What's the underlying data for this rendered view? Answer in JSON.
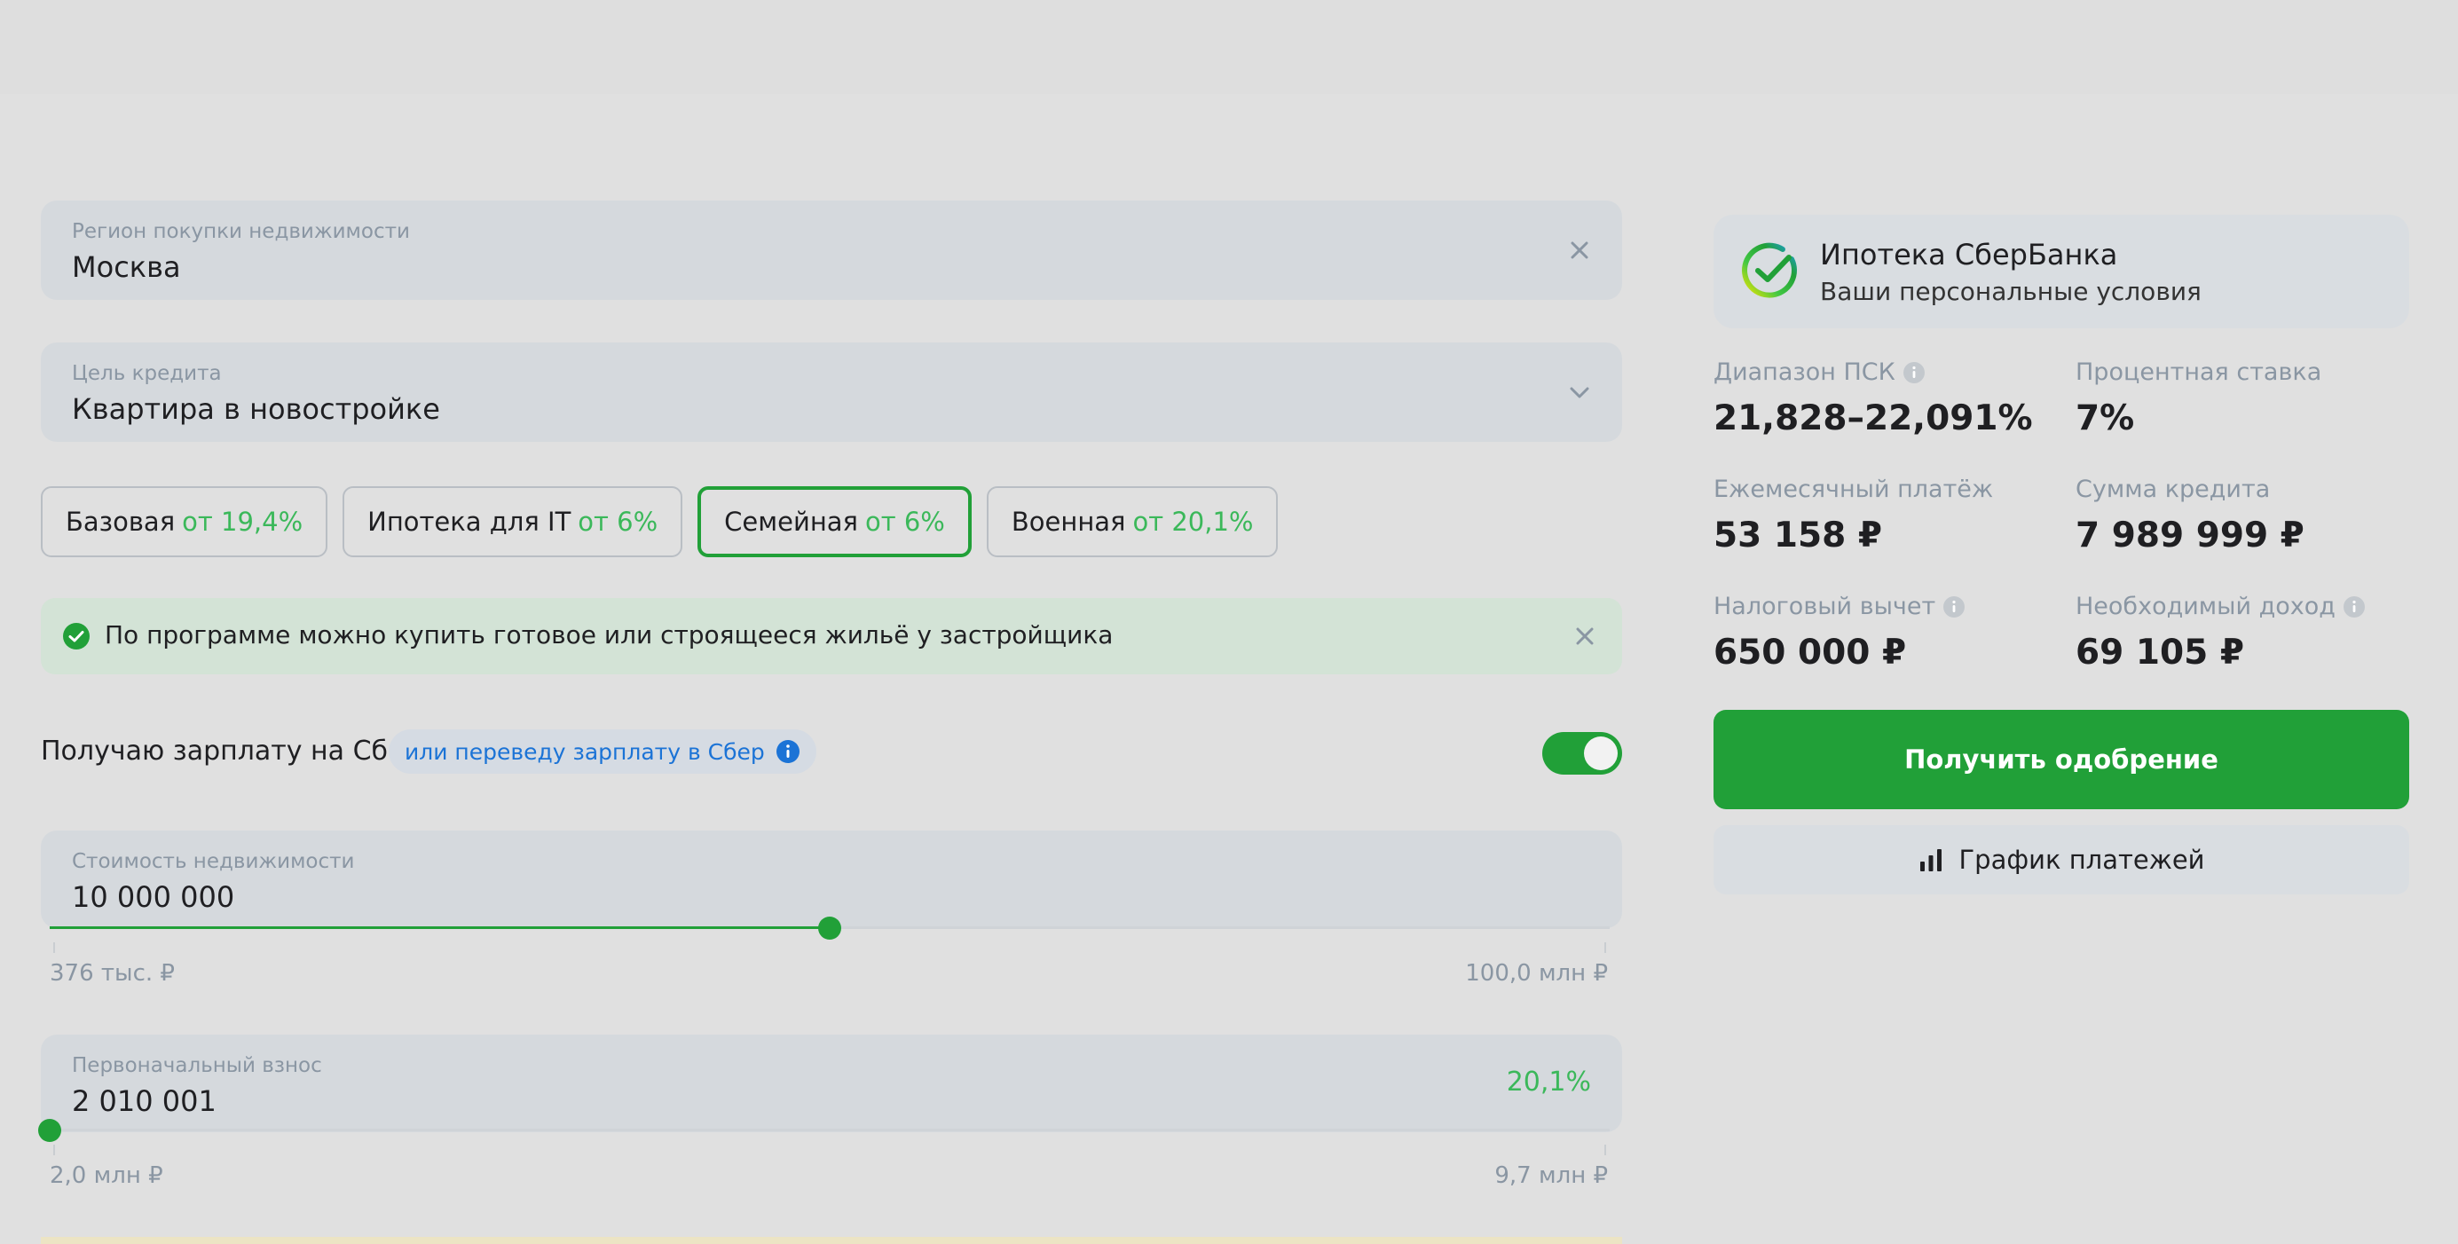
{
  "region": {
    "label": "Регион покупки недвижимости",
    "value": "Москва",
    "clear_icon": "close-icon"
  },
  "purpose": {
    "label": "Цель кредита",
    "value": "Квартира в новостройке",
    "dropdown_icon": "chevron-down-icon"
  },
  "programs": [
    {
      "name": "Базовая",
      "rate": "от 19,4%",
      "selected": false
    },
    {
      "name": "Ипотека для IT",
      "rate": "от 6%",
      "selected": false
    },
    {
      "name": "Семейная",
      "rate": "от 6%",
      "selected": true
    },
    {
      "name": "Военная",
      "rate": "от 20,1%",
      "selected": false
    }
  ],
  "notice": {
    "text": "По программе можно купить готовое или строящееся жильё у застройщика",
    "icon": "check-circle-icon"
  },
  "salary": {
    "label": "Получаю зарплату на Сбер",
    "link": "или переведу зарплату в Сбер",
    "toggle_on": true
  },
  "price": {
    "label": "Стоимость недвижимости",
    "value": "10 000 000",
    "min": "376 тыс. ₽",
    "max": "100,0 млн ₽",
    "slider_fraction": 0.5
  },
  "down_payment": {
    "label": "Первоначальный взнос",
    "value": "2 010 001",
    "percent": "20,1%",
    "min": "2,0 млн ₽",
    "max": "9,7 млн ₽",
    "slider_fraction": 0.0
  },
  "offer": {
    "title": "Ипотека СберБанка",
    "subtitle": "Ваши персональные условия",
    "stats": [
      {
        "label": "Диапазон ПСК",
        "value": "21,828–22,091%",
        "info": true
      },
      {
        "label": "Процентная ставка",
        "value": "7%",
        "info": false
      },
      {
        "label": "Ежемесячный платёж",
        "value": "53 158 ₽",
        "info": false
      },
      {
        "label": "Сумма кредита",
        "value": "7 989 999 ₽",
        "info": false
      },
      {
        "label": "Налоговый вычет",
        "value": "650 000 ₽",
        "info": true
      },
      {
        "label": "Необходимый доход",
        "value": "69 105 ₽",
        "info": true
      }
    ],
    "approve_label": "Получить одобрение",
    "schedule_label": "График платежей"
  },
  "colors": {
    "accent": "#21a038",
    "link": "#1b73d6",
    "rate_green": "#3bb85a"
  }
}
